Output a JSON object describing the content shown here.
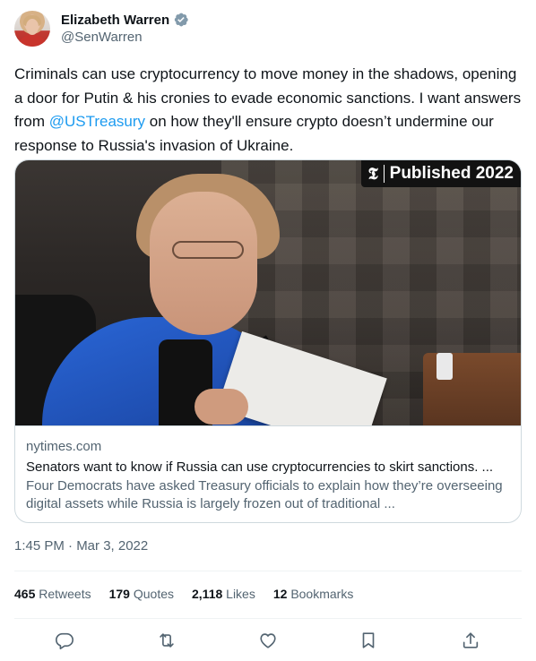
{
  "author": {
    "display_name": "Elizabeth Warren",
    "handle": "@SenWarren",
    "verified_badge_icon": "verified-badge-icon",
    "verified_color": "#829aab"
  },
  "tweet": {
    "text_before_mention": "Criminals can use cryptocurrency to move money in the shadows, opening a door for Putin & his cronies to evade economic sanctions. I want answers from ",
    "mention": "@USTreasury",
    "text_after_mention": " on how they'll ensure crypto doesn’t undermine our response to Russia's invasion of Ukraine.",
    "mention_color": "#1d9bf0"
  },
  "card": {
    "badge_logo": "𝕿",
    "badge_text": "Published 2022",
    "domain": "nytimes.com",
    "title": "Senators want to know if Russia can use cryptocurrencies to skirt sanctions. ...",
    "description": "Four Democrats have asked Treasury officials to explain how they’re overseeing digital assets while Russia is largely frozen out of traditional ..."
  },
  "timestamp": "1:45 PM · Mar 3, 2022",
  "stats": [
    {
      "count": "465",
      "label": "Retweets"
    },
    {
      "count": "179",
      "label": "Quotes"
    },
    {
      "count": "2,118",
      "label": "Likes"
    },
    {
      "count": "12",
      "label": "Bookmarks"
    }
  ],
  "actions": [
    "reply-icon",
    "retweet-icon",
    "like-icon",
    "bookmark-icon",
    "share-icon"
  ]
}
